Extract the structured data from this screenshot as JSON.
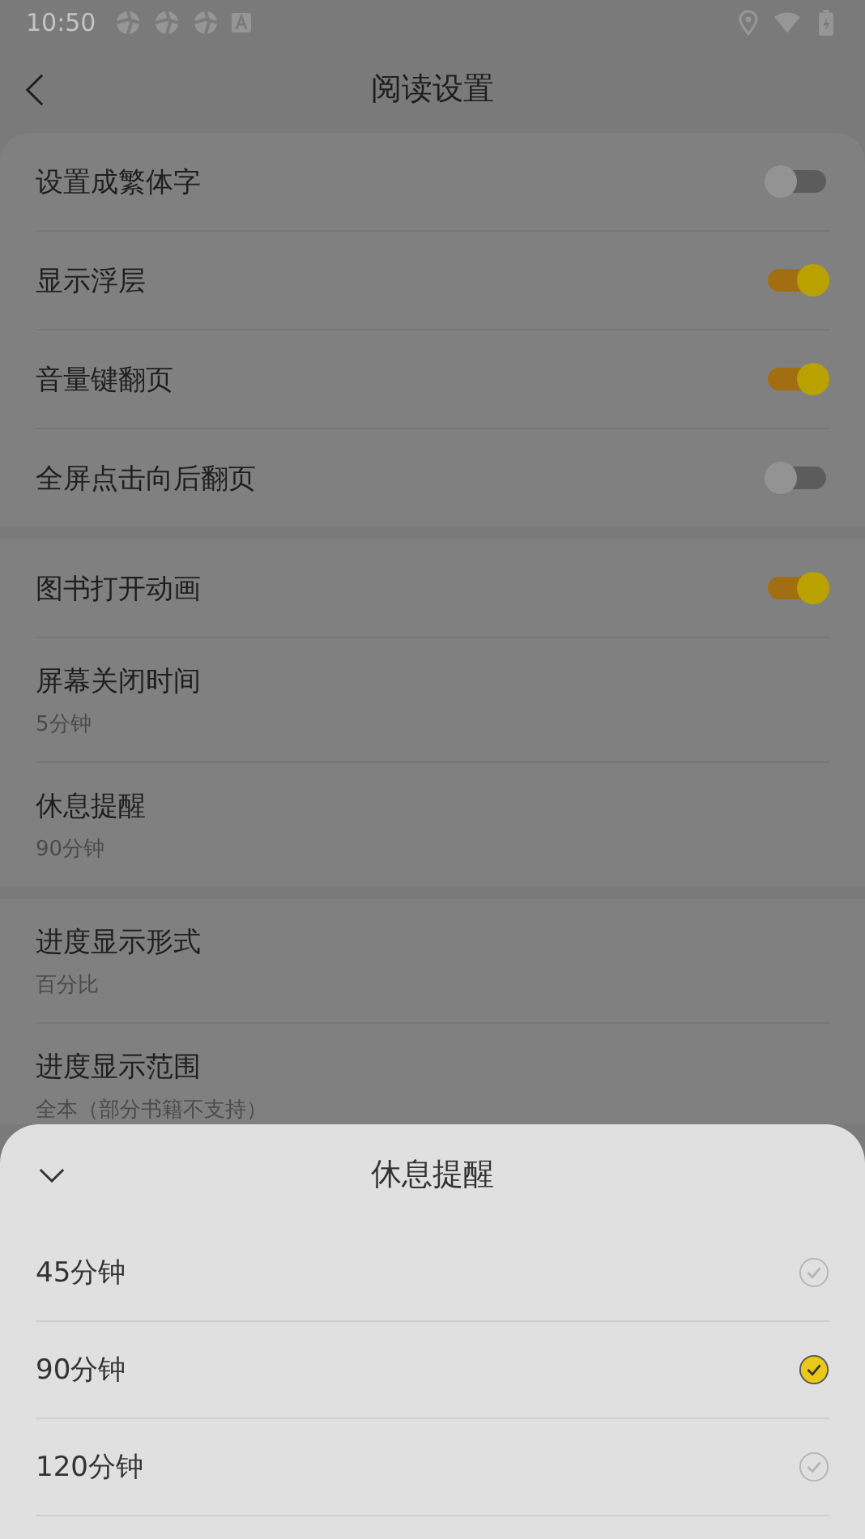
{
  "status_bar": {
    "time": "10:50"
  },
  "header": {
    "title": "阅读设置"
  },
  "groups": [
    {
      "items": [
        {
          "kind": "toggle",
          "label": "设置成繁体字",
          "on": false
        },
        {
          "kind": "toggle",
          "label": "显示浮层",
          "on": true
        },
        {
          "kind": "toggle",
          "label": "音量键翻页",
          "on": true
        },
        {
          "kind": "toggle",
          "label": "全屏点击向后翻页",
          "on": false
        }
      ]
    },
    {
      "items": [
        {
          "kind": "toggle",
          "label": "图书打开动画",
          "on": true
        },
        {
          "kind": "value",
          "label": "屏幕关闭时间",
          "value": "5分钟"
        },
        {
          "kind": "value",
          "label": "休息提醒",
          "value": "90分钟"
        }
      ]
    },
    {
      "items": [
        {
          "kind": "value",
          "label": "进度显示形式",
          "value": "百分比"
        },
        {
          "kind": "value",
          "label": "进度显示范围",
          "value": "全本（部分书籍不支持）"
        }
      ]
    }
  ],
  "sheet": {
    "title": "休息提醒",
    "options": [
      {
        "label": "45分钟",
        "selected": false
      },
      {
        "label": "90分钟",
        "selected": true
      },
      {
        "label": "120分钟",
        "selected": false
      }
    ]
  }
}
